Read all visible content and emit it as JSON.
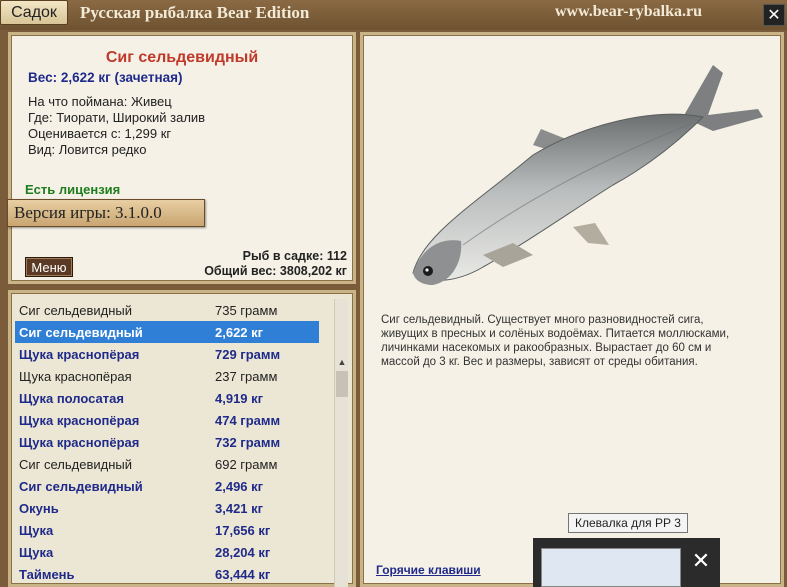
{
  "titlebar": {
    "tab_label": "Садок",
    "app_title": "Русская рыбалка Bear Edition",
    "site_url": "www.bear-rybalka.ru",
    "close_glyph": "✕"
  },
  "info": {
    "fish_title": "Сиг сельдевидный",
    "weight_line": "Вес: 2,622 кг (зачетная)",
    "rows": [
      "На что поймана: Живец",
      "Где: Тиорати, Широкий залив",
      "Оценивается с: 1,299 кг",
      "Вид: Ловится редко"
    ],
    "license": "Есть лицензия",
    "version": "Версия игры: 3.1.0.0",
    "menu_button": "Меню",
    "fish_count": "Рыб в садке: 112",
    "total_weight": "Общий вес: 3808,202 кг"
  },
  "list": {
    "items": [
      {
        "name": "Сиг сельдевидный",
        "weight": "735 грамм",
        "style": "normal"
      },
      {
        "name": "Сиг сельдевидный",
        "weight": "2,622 кг",
        "style": "selected"
      },
      {
        "name": "Щука краснопёрая",
        "weight": "729 грамм",
        "style": "bold"
      },
      {
        "name": "Щука краснопёрая",
        "weight": "237 грамм",
        "style": "normal"
      },
      {
        "name": "Щука полосатая",
        "weight": "4,919 кг",
        "style": "bold"
      },
      {
        "name": "Щука краснопёрая",
        "weight": "474 грамм",
        "style": "bold"
      },
      {
        "name": "Щука краснопёрая",
        "weight": "732 грамм",
        "style": "bold"
      },
      {
        "name": "Сиг сельдевидный",
        "weight": "692 грамм",
        "style": "normal"
      },
      {
        "name": "Сиг сельдевидный",
        "weight": "2,496 кг",
        "style": "bold"
      },
      {
        "name": "Окунь",
        "weight": "3,421 кг",
        "style": "bold"
      },
      {
        "name": "Щука",
        "weight": "17,656 кг",
        "style": "bold"
      },
      {
        "name": "Щука",
        "weight": "28,204 кг",
        "style": "bold"
      },
      {
        "name": "Таймень",
        "weight": "63,444 кг",
        "style": "bold"
      }
    ]
  },
  "detail": {
    "description": "Сиг сельдевидный. Существует много разновидностей сига, живущих в пресных и солёных водоёмах. Питается моллюсками, личинками насекомых и ракообразных. Вырастает до 60 см и массой до 3 кг. Вес и размеры, зависят от среды обитания.",
    "hotkeys_link": "Горячие клавиши"
  },
  "taskbar_preview": {
    "tooltip": "Клевалка для РР 3",
    "close_glyph": "✕"
  }
}
